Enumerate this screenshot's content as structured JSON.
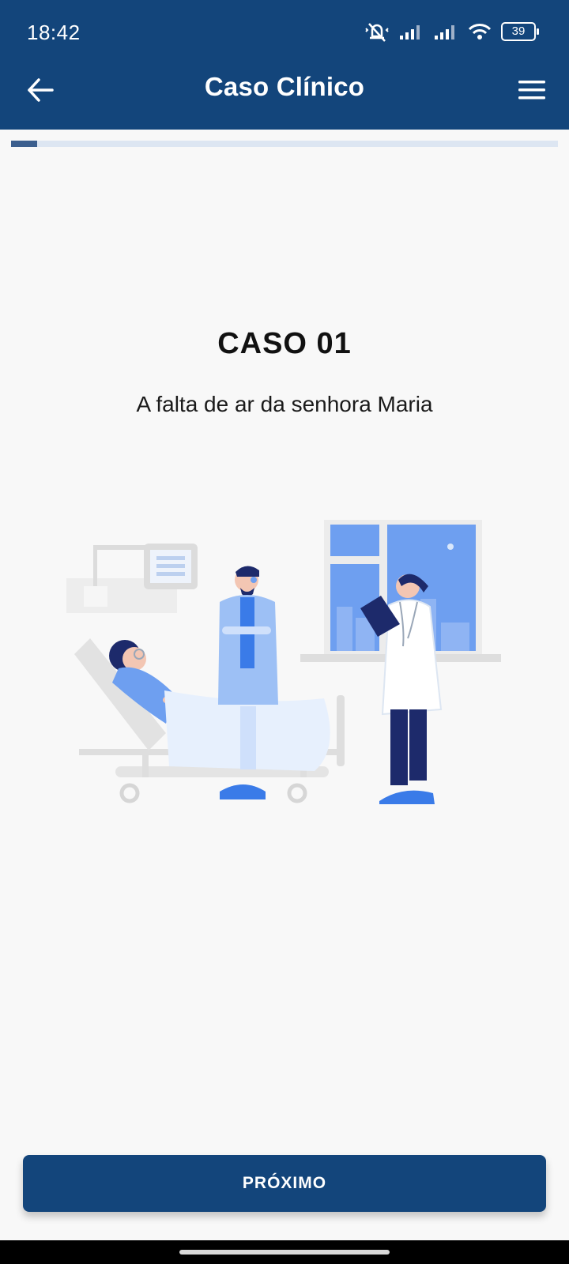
{
  "status_bar": {
    "time": "18:42",
    "battery": "39",
    "icons": [
      "mute-vibrate-icon",
      "signal-icon",
      "signal-icon",
      "wifi-icon",
      "battery-icon"
    ]
  },
  "app_bar": {
    "title": "Caso Clínico",
    "back_icon": "arrow-left-icon",
    "menu_icon": "hamburger-menu-icon"
  },
  "progress": {
    "value": 0.047
  },
  "case": {
    "title": "CASO 01",
    "subtitle": "A falta de ar da senhora Maria"
  },
  "illustration": {
    "name": "hospital-room-illustration"
  },
  "footer": {
    "next_label": "PRÓXIMO"
  },
  "colors": {
    "primary": "#13457b",
    "background": "#f8f8f8",
    "progress_track": "#dde6f2",
    "progress_fill": "#3c5f8e",
    "accent_blue": "#6e9ff0"
  }
}
